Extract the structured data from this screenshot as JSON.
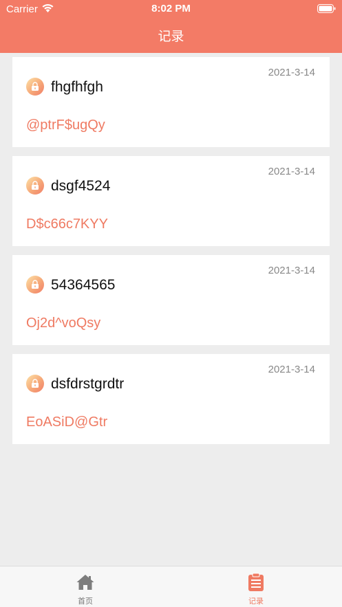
{
  "status_bar": {
    "carrier": "Carrier",
    "time": "8:02 PM"
  },
  "nav": {
    "title": "记录"
  },
  "records": [
    {
      "name": "fhgfhfgh",
      "password": "@ptrF$ugQy",
      "date": "2021-3-14"
    },
    {
      "name": "dsgf4524",
      "password": "D$c66c7KYY",
      "date": "2021-3-14"
    },
    {
      "name": "54364565",
      "password": "Oj2d^voQsy",
      "date": "2021-3-14"
    },
    {
      "name": "dsfdrstgrdtr",
      "password": "EoASiD@Gtr",
      "date": "2021-3-14"
    }
  ],
  "tabbar": {
    "items": [
      {
        "label": "首页",
        "icon": "home-icon",
        "active": false
      },
      {
        "label": "记录",
        "icon": "clipboard-icon",
        "active": true
      }
    ]
  },
  "colors": {
    "accent": "#f37b66",
    "password_text": "#ef7a62",
    "tab_inactive": "#777777"
  }
}
